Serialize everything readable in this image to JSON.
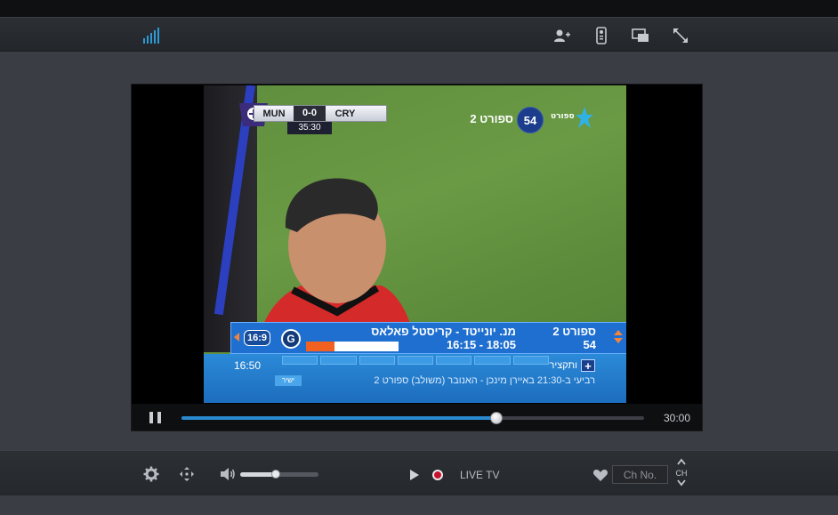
{
  "header": {
    "signal_icon": "signal-bars-icon",
    "icons": [
      "add-user-icon",
      "remote-control-icon",
      "picture-in-picture-icon",
      "fullscreen-icon"
    ],
    "accent": "#2d9ad6"
  },
  "video": {
    "scorebug": {
      "home": "MUN",
      "score": "0-0",
      "away": "CRY",
      "clock": "35:30"
    },
    "channel_logo": {
      "number": "54",
      "name": "ספורט 2",
      "brand": "ספורט"
    },
    "info_bar": {
      "aspect_ratio": "16:9",
      "rating": "G",
      "program_title": "מנ. יונייטד - קריסטל פאלאס",
      "time_range": "16:15 - 18:05",
      "channel_name": "ספורט 2",
      "channel_number": "54",
      "progress_fraction": 0.31
    },
    "epg": {
      "clock": "16:50",
      "label": "ותקציר",
      "plus": "+",
      "ticker": "רביעי ב-21:30 באיירן מינכן - האנובר (משולב) ספורט 2",
      "tag": "ישיר"
    }
  },
  "playback": {
    "state": "paused",
    "pause_icon": "pause-icon",
    "progress_fraction": 0.68,
    "duration": "30:00"
  },
  "bottom": {
    "volume_fraction": 0.45,
    "live_label": "LIVE TV",
    "channel_input_placeholder": "Ch No.",
    "ch_label": "CH",
    "record_color": "#c8102e"
  }
}
